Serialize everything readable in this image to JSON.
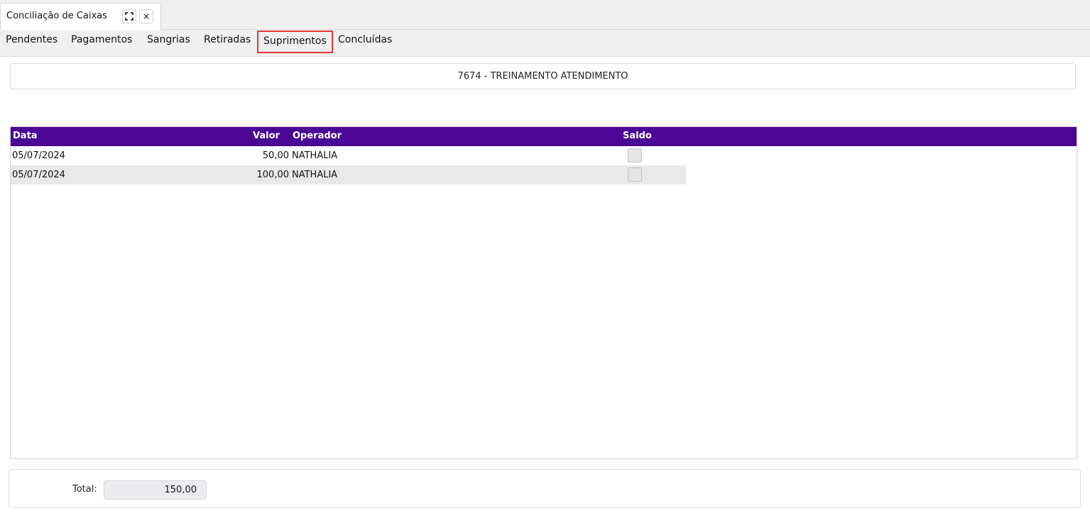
{
  "window_tab": {
    "title": "Conciliação de Caixas",
    "expand_icon": "expand-icon",
    "close_label": "×"
  },
  "subtabs": [
    {
      "label": "Pendentes",
      "active": false
    },
    {
      "label": "Pagamentos",
      "active": false
    },
    {
      "label": "Sangrias",
      "active": false
    },
    {
      "label": "Retiradas",
      "active": false
    },
    {
      "label": "Suprimentos",
      "active": true
    },
    {
      "label": "Concluídas",
      "active": false
    }
  ],
  "header": {
    "title": "7674 - TREINAMENTO ATENDIMENTO"
  },
  "table": {
    "columns": {
      "data": "Data",
      "valor": "Valor",
      "operador": "Operador",
      "saldo": "Saldo"
    },
    "rows": [
      {
        "data": "05/07/2024",
        "valor": "50,00",
        "operador": "NATHALIA",
        "saldo": false
      },
      {
        "data": "05/07/2024",
        "valor": "100,00",
        "operador": "NATHALIA",
        "saldo": false
      }
    ]
  },
  "footer": {
    "total_label": "Total:",
    "total_value": "150,00"
  },
  "colors": {
    "header_bg": "#4a0796",
    "active_tab_border": "#e53935"
  }
}
